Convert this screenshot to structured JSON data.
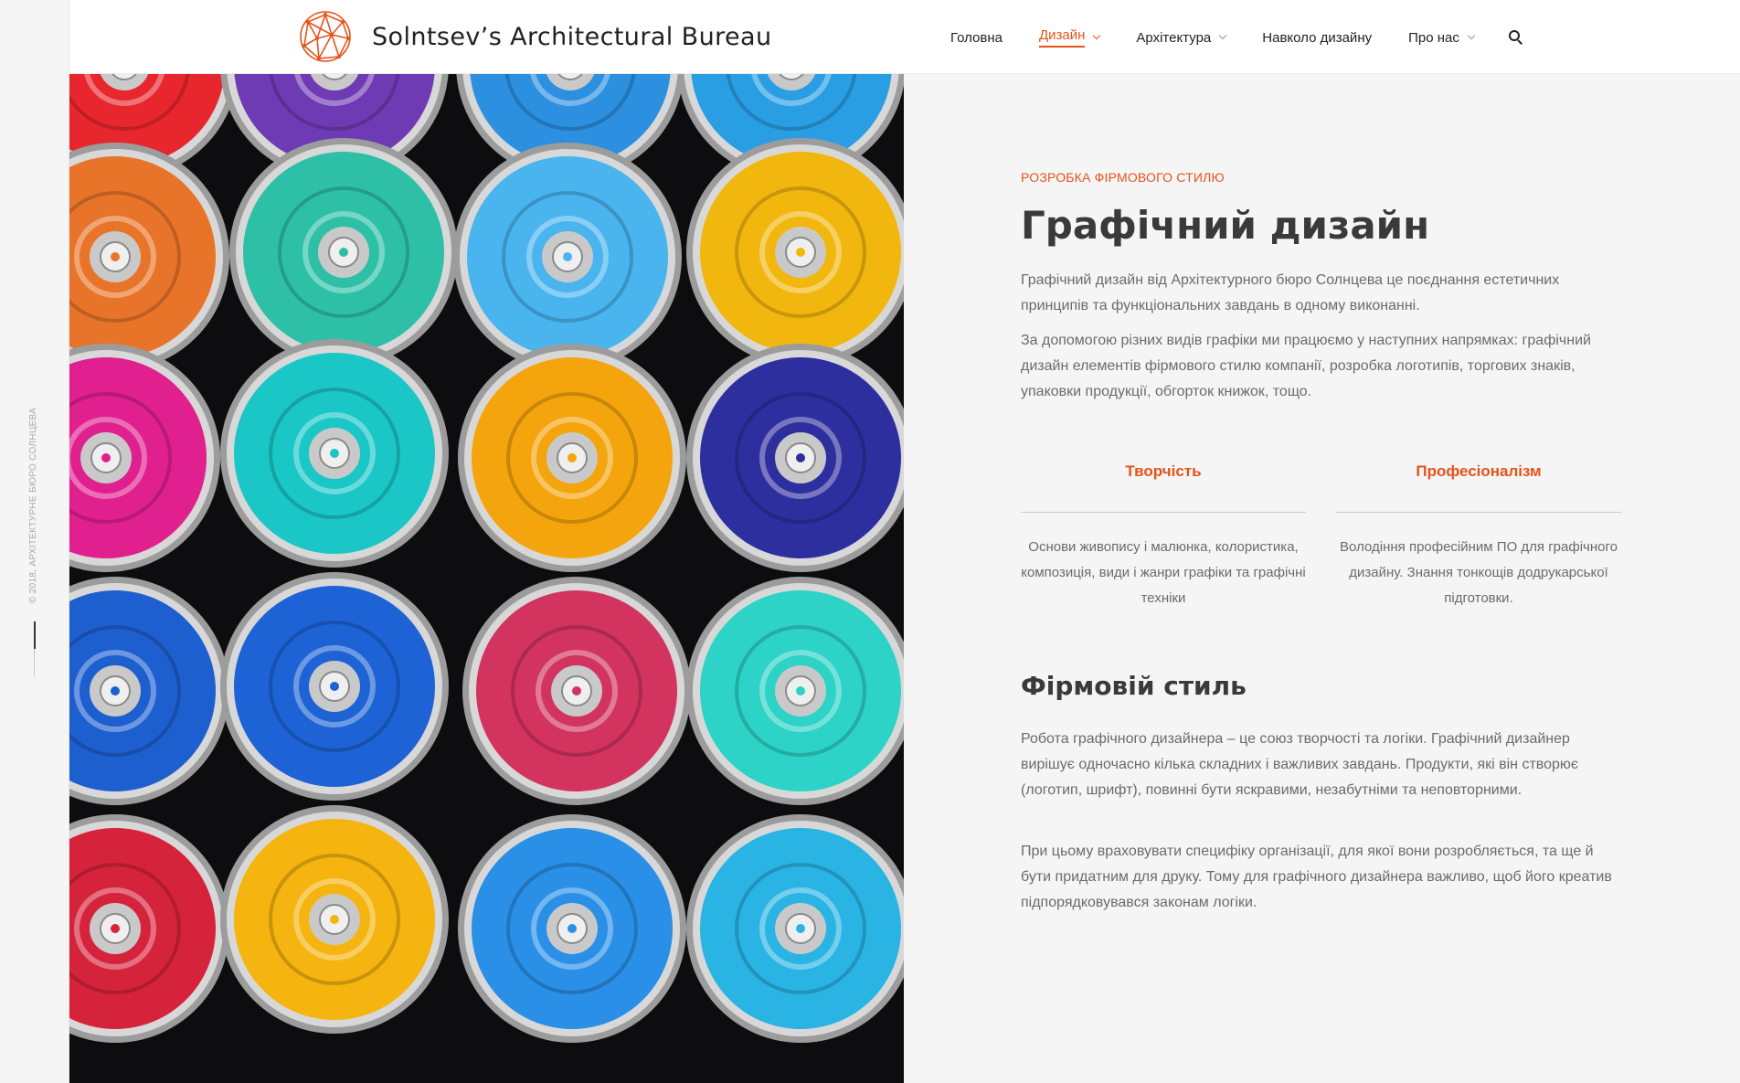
{
  "rail": {
    "copyright": "© 2018, АРХІТЕКТУРНЕ БЮРО СОЛНЦЕВА"
  },
  "header": {
    "logo_text": "Solntsev’s Architectural Bureau",
    "nav": [
      {
        "label": "Головна",
        "has_submenu": false,
        "active": false
      },
      {
        "label": "Дизайн",
        "has_submenu": true,
        "active": true
      },
      {
        "label": "Архітектура",
        "has_submenu": true,
        "active": false
      },
      {
        "label": "Навколо дизайну",
        "has_submenu": false,
        "active": false
      },
      {
        "label": "Про нас",
        "has_submenu": true,
        "active": false
      }
    ],
    "search_icon": "search-icon"
  },
  "colors": {
    "accent": "#e5531a",
    "heading": "#3a3a3a",
    "body_text": "#6b6b6b",
    "background": "#f5f5f5"
  },
  "hero": {
    "alt_subject": "spray paint cans"
  },
  "content": {
    "kicker": "РОЗРОБКА ФІРМОВОГО СТИЛЮ",
    "title": "Графічний дизайн",
    "paragraph1": "Графічний дизайн від Архітектурного бюро Солнцева це поєднання естетичних принципів та функціональних завдань в одному виконанні.",
    "paragraph2": "За допомогою різних видів графіки ми  працюємо у наступних напрямках: графічний дизайн елементів фірмового стилю компанії,  розробка логотипів, торгових знаків, упаковки продукції, обгорток книжок, тощо.",
    "features": [
      {
        "title": "Творчість",
        "text": "Основи живопису і малюнка, колористика, композиція, види і жанри графіки та графічні техніки"
      },
      {
        "title": "Професіоналізм",
        "text": "Володіння професійним ПО для графічного дизайну. Знання тонкощів додрукарської підготовки."
      }
    ],
    "subtitle": "Фірмовій стиль",
    "paragraph3": "Робота графічного дизайнера – це союз творчості та логіки. Графічний дизайнер вирішує одночасно кілька складних і важливих завдань. Продукти, які він створює (логотип, шрифт), повинні бути яскравими, незабутніми та неповторними.",
    "paragraph4": "При цьому враховувати специфіку організації, для якої вони розробляється, та ще й бути придатним для друку. Тому для графічного дизайнера важливо, щоб його креатив підпорядковувався законам логіки."
  }
}
